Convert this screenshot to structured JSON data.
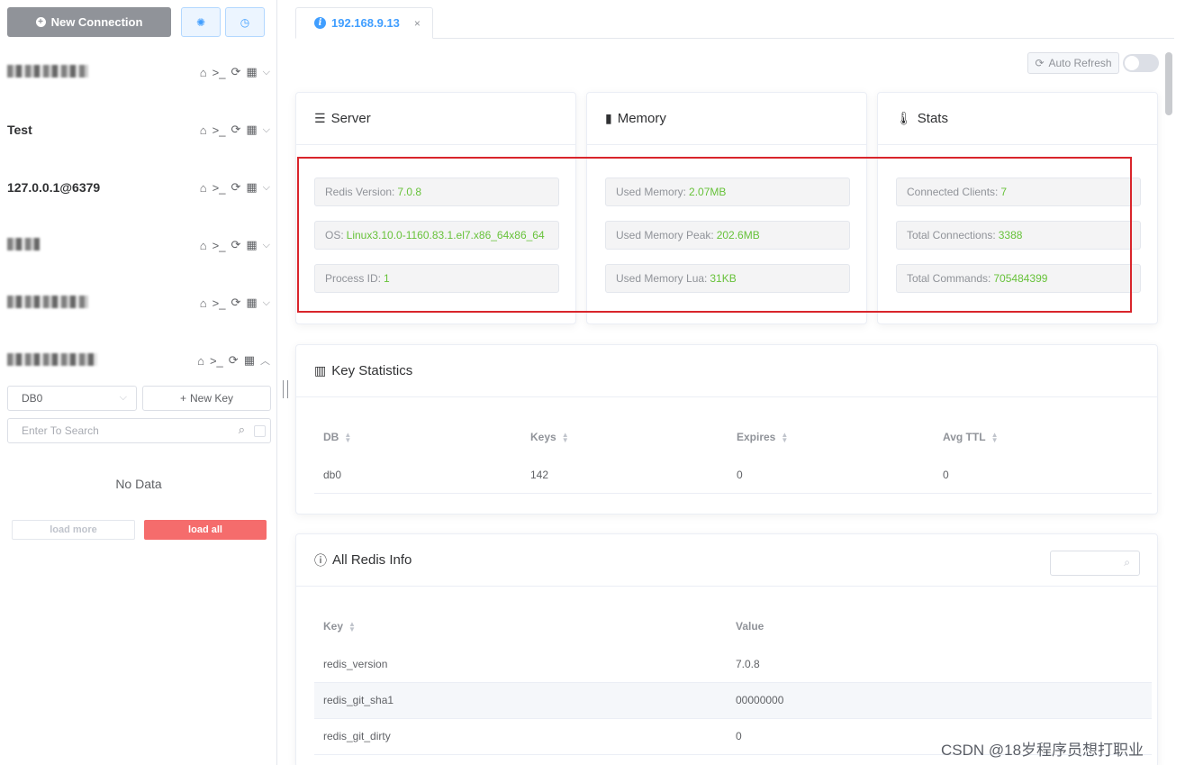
{
  "sidebar": {
    "new_connection_label": "New Connection",
    "settings_icon": "gear-icon",
    "history_icon": "clock-icon",
    "connections": [
      {
        "name": "",
        "expanded": false
      },
      {
        "name": "Test",
        "expanded": false
      },
      {
        "name": "127.0.0.1@6379",
        "expanded": false
      },
      {
        "name": "",
        "expanded": false
      },
      {
        "name": "",
        "expanded": false
      },
      {
        "name": "",
        "expanded": true
      }
    ],
    "db_select_value": "DB0",
    "new_key_label": "New Key",
    "search_placeholder": "Enter To Search",
    "no_data_text": "No Data",
    "load_more_label": "load more",
    "load_all_label": "load all"
  },
  "tab": {
    "title": "192.168.9.13",
    "close": "×"
  },
  "toolbar": {
    "auto_refresh_label": "Auto Refresh",
    "auto_refresh_on": false
  },
  "cards": {
    "server": {
      "title": "Server",
      "items": [
        {
          "label": "Redis Version:",
          "value": "7.0.8"
        },
        {
          "label": "OS:",
          "value": "Linux3.10.0-1160.83.1.el7.x86_64x86_64"
        },
        {
          "label": "Process ID:",
          "value": "1"
        }
      ]
    },
    "memory": {
      "title": "Memory",
      "items": [
        {
          "label": "Used Memory:",
          "value": "2.07MB"
        },
        {
          "label": "Used Memory Peak:",
          "value": "202.6MB"
        },
        {
          "label": "Used Memory Lua:",
          "value": "31KB"
        }
      ]
    },
    "stats": {
      "title": "Stats",
      "items": [
        {
          "label": "Connected Clients:",
          "value": "7"
        },
        {
          "label": "Total Connections:",
          "value": "3388"
        },
        {
          "label": "Total Commands:",
          "value": "705484399"
        }
      ]
    }
  },
  "key_statistics": {
    "title": "Key Statistics",
    "columns": [
      "DB",
      "Keys",
      "Expires",
      "Avg TTL"
    ],
    "rows": [
      [
        "db0",
        "142",
        "0",
        "0"
      ]
    ]
  },
  "all_redis_info": {
    "title": "All Redis Info",
    "columns": [
      "Key",
      "Value"
    ],
    "rows": [
      [
        "redis_version",
        "7.0.8"
      ],
      [
        "redis_git_sha1",
        "00000000"
      ],
      [
        "redis_git_dirty",
        "0"
      ]
    ]
  },
  "watermark": "CSDN @18岁程序员想打职业",
  "colors": {
    "accent": "#409eff",
    "value_green": "#67c23a",
    "danger": "#f56c6c",
    "highlight_box": "#d9252b"
  }
}
